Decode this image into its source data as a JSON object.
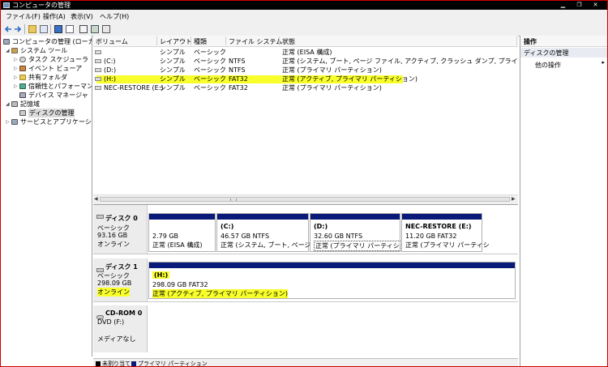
{
  "window": {
    "title": "コンピュータの管理"
  },
  "menu": [
    "ファイル(F)",
    "操作(A)",
    "表示(V)",
    "ヘルプ(H)"
  ],
  "toolbar": {
    "icons": [
      "back-arrow",
      "forward-arrow",
      "up-folder",
      "show-tree",
      "help",
      "properties",
      "export-list",
      "refresh"
    ]
  },
  "tree": [
    {
      "label": "コンピュータの管理 (ローカル)",
      "icon": "computer-icon",
      "level": 0
    },
    {
      "label": "システム ツール",
      "icon": "tools-icon",
      "level": 1
    },
    {
      "label": "タスク スケジューラ",
      "icon": "clock-icon",
      "level": 2
    },
    {
      "label": "イベント ビューア",
      "icon": "event-viewer-icon",
      "level": 2
    },
    {
      "label": "共有フォルダ",
      "icon": "shared-folder-icon",
      "level": 2
    },
    {
      "label": "信頼性とパフォーマンス",
      "icon": "performance-icon",
      "level": 2
    },
    {
      "label": "デバイス マネージャ",
      "icon": "device-manager-icon",
      "level": 2
    },
    {
      "label": "記憶域",
      "icon": "storage-icon",
      "level": 1
    },
    {
      "label": "ディスクの管理",
      "icon": "disk-management-icon",
      "level": 2
    },
    {
      "label": "サービスとアプリケーション",
      "icon": "services-icon",
      "level": 1
    }
  ],
  "volumes": {
    "headers": [
      "ボリューム",
      "レイアウト",
      "種類",
      "ファイル システム",
      "状態"
    ],
    "rows": [
      {
        "volume": "",
        "layout": "シンプル",
        "type": "ベーシック",
        "fs": "",
        "status": "正常 (EISA 構成)"
      },
      {
        "volume": "(C:)",
        "layout": "シンプル",
        "type": "ベーシック",
        "fs": "NTFS",
        "status": "正常 (システム, ブート, ページ ファイル, アクティブ, クラッシュ ダンプ, プライマリ パー"
      },
      {
        "volume": "(D:)",
        "layout": "シンプル",
        "type": "ベーシック",
        "fs": "NTFS",
        "status": "正常 (プライマリ パーティション)"
      },
      {
        "volume": "(H:)",
        "layout": "シンプル",
        "type": "ベーシック",
        "fs": "FAT32",
        "status": "正常 (アクティブ, プライマリ パーティション)"
      },
      {
        "volume": "NEC-RESTORE (E:)",
        "layout": "シンプル",
        "type": "ベーシック",
        "fs": "FAT32",
        "status": "正常 (プライマリ パーティション)"
      }
    ]
  },
  "disks": [
    {
      "name": "ディスク 0",
      "type": "ベーシック",
      "size": "93.16 GB",
      "status": "オンライン",
      "partitions": [
        {
          "label": "",
          "size": "2.79 GB",
          "status": "正常 (EISA 構成)"
        },
        {
          "label": "(C:)",
          "size": "46.57 GB NTFS",
          "status": "正常 (システム, ブート, ページ ファ"
        },
        {
          "label": "(D:)",
          "size": "32.60 GB NTFS",
          "status": "正常 (プライマリ パーティション)"
        },
        {
          "label": "NEC-RESTORE  (E:)",
          "size": "11.20 GB FAT32",
          "status": "正常 (プライマリ パーティシ"
        }
      ]
    },
    {
      "name": "ディスク 1",
      "type": "ベーシック",
      "size": "298.09 GB",
      "status": "オンライン",
      "partitions": [
        {
          "label": "(H:)",
          "size": "298.09 GB FAT32",
          "status": "正常 (アクティブ, プライマリ パーティション)"
        }
      ]
    },
    {
      "name": "CD-ROM 0",
      "type": "DVD (F:)",
      "size": "",
      "status": "メディアなし",
      "partitions": []
    }
  ],
  "actions": {
    "header": "操作",
    "section": "ディスクの管理",
    "more": "他の操作",
    "more_caret": "▸"
  },
  "legend": [
    {
      "label": "未割り当て",
      "color": "#000000"
    },
    {
      "label": "プライマリ パーティション",
      "color": "#0a1a78"
    }
  ],
  "colors": {
    "highlight": "#f8ff2a",
    "partition_bar": "#0a1a78",
    "title_bar": "#000000"
  }
}
